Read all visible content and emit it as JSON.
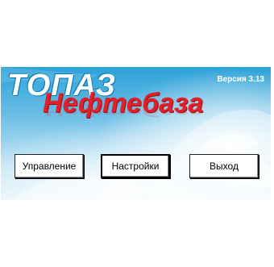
{
  "splash": {
    "logo_line1": "ТОПАЗ",
    "logo_line2": "Нефтебаза",
    "version": "Версия 3.13"
  },
  "buttons": {
    "manage": "Управление",
    "settings": "Настройки",
    "exit": "Выход"
  },
  "colors": {
    "logo_red": "#e0202a",
    "sky_blue": "#2aa2d8"
  }
}
